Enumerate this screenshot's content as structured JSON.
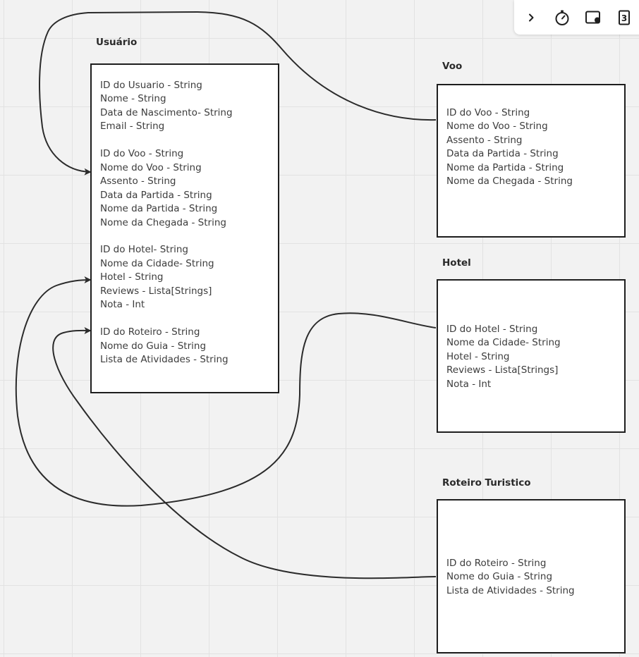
{
  "toolbar": {
    "icons": [
      "chevron-right-icon",
      "timer-icon",
      "screen-share-icon",
      "page-count-icon"
    ],
    "page_count": "3"
  },
  "canvas": {
    "usuario": {
      "title": "Usuário",
      "groups": [
        [
          "ID do Usuario - String",
          "Nome - String",
          "Data de Nascimento- String",
          "Email - String"
        ],
        [
          "ID do Voo - String",
          "Nome do Voo - String",
          "Assento - String",
          "Data da Partida - String",
          "Nome da Partida - String",
          "Nome da Chegada - String"
        ],
        [
          "ID do Hotel- String",
          "Nome da Cidade- String",
          "Hotel - String",
          "Reviews - Lista[Strings]",
          "Nota - Int"
        ],
        [
          "ID do Roteiro - String",
          "Nome do Guia - String",
          "Lista de Atividades - String"
        ]
      ]
    },
    "voo": {
      "title": "Voo",
      "fields": [
        "ID do Voo - String",
        "Nome do Voo - String",
        "Assento - String",
        "Data da Partida - String",
        "Nome da Partida - String",
        "Nome da Chegada - String"
      ]
    },
    "hotel": {
      "title": "Hotel",
      "fields": [
        "ID do Hotel - String",
        "Nome da Cidade- String",
        "Hotel - String",
        "Reviews - Lista[Strings]",
        "Nota - Int"
      ]
    },
    "roteiro": {
      "title": "Roteiro Turistico",
      "fields": [
        "ID do Roteiro - String",
        "Nome do Guia - String",
        "Lista de Atividades - String"
      ]
    },
    "connectors": [
      {
        "from": "voo",
        "to": "usuario"
      },
      {
        "from": "hotel",
        "to": "usuario"
      },
      {
        "from": "roteiro",
        "to": "usuario"
      }
    ],
    "colors": {
      "background": "#f2f2f2",
      "grid": "#e2e2e2",
      "box_border": "#1e1e1e",
      "connector": "#2b2b2b",
      "text": "#3c3c3c"
    }
  }
}
